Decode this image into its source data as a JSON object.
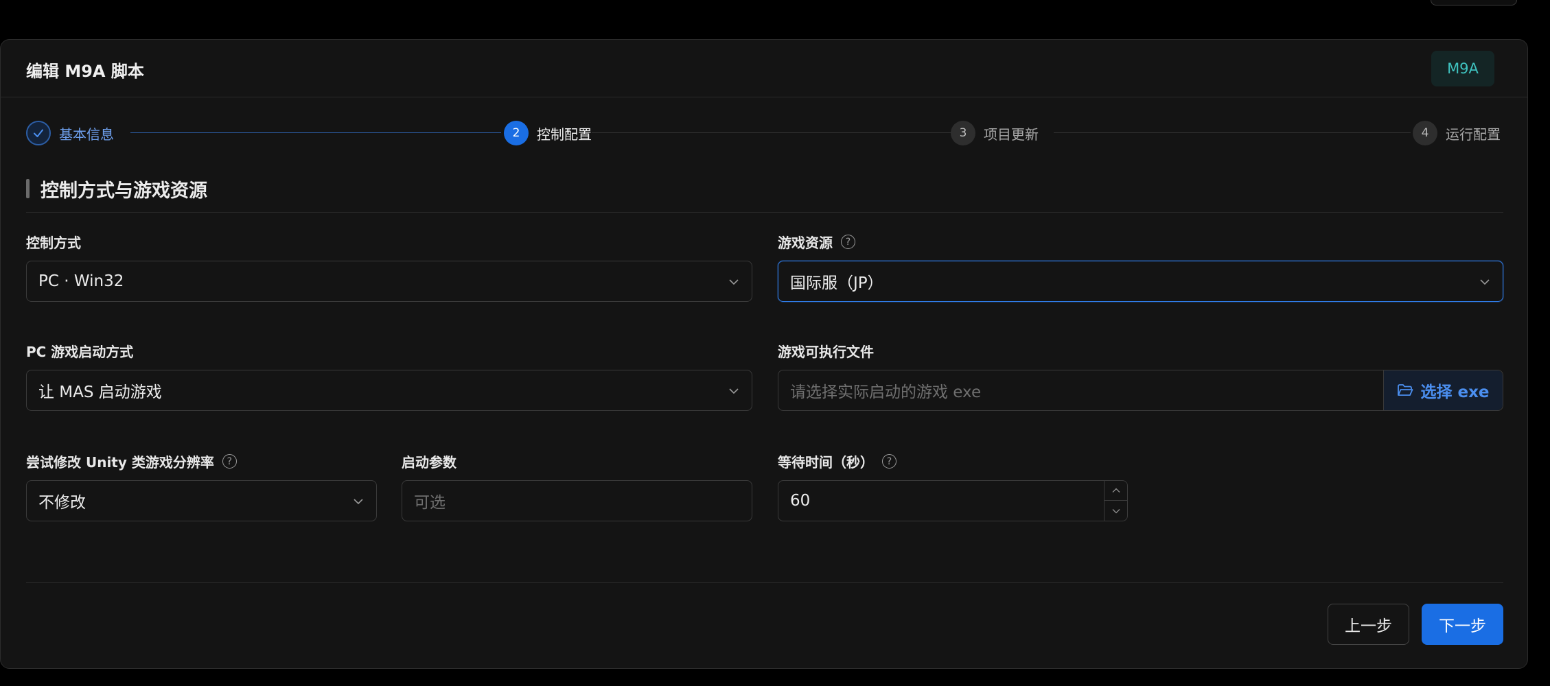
{
  "dialog": {
    "title": "编辑 M9A 脚本",
    "tag": "M9A"
  },
  "steps": [
    {
      "number": "",
      "label": "基本信息",
      "state": "done"
    },
    {
      "number": "2",
      "label": "控制配置",
      "state": "active"
    },
    {
      "number": "3",
      "label": "项目更新",
      "state": "pending"
    },
    {
      "number": "4",
      "label": "运行配置",
      "state": "pending"
    }
  ],
  "section": {
    "title": "控制方式与游戏资源"
  },
  "fields": {
    "control_method": {
      "label": "控制方式",
      "value": "PC · Win32"
    },
    "game_resource": {
      "label": "游戏资源",
      "value": "国际服（JP）",
      "help": "?"
    },
    "launch_method": {
      "label": "PC 游戏启动方式",
      "value": "让 MAS 启动游戏"
    },
    "executable": {
      "label": "游戏可执行文件",
      "placeholder": "请选择实际启动的游戏 exe",
      "button": "选择 exe"
    },
    "unity_resolution": {
      "label": "尝试修改 Unity 类游戏分辨率",
      "value": "不修改",
      "help": "?"
    },
    "launch_args": {
      "label": "启动参数",
      "placeholder": "可选"
    },
    "wait_time": {
      "label": "等待时间（秒）",
      "value": "60",
      "help": "?"
    }
  },
  "footer": {
    "prev_label": "上一步",
    "next_label": "下一步"
  },
  "colors": {
    "accent": "#1a6ee4",
    "tag_text": "#3fc3c0",
    "background": "#141414"
  }
}
